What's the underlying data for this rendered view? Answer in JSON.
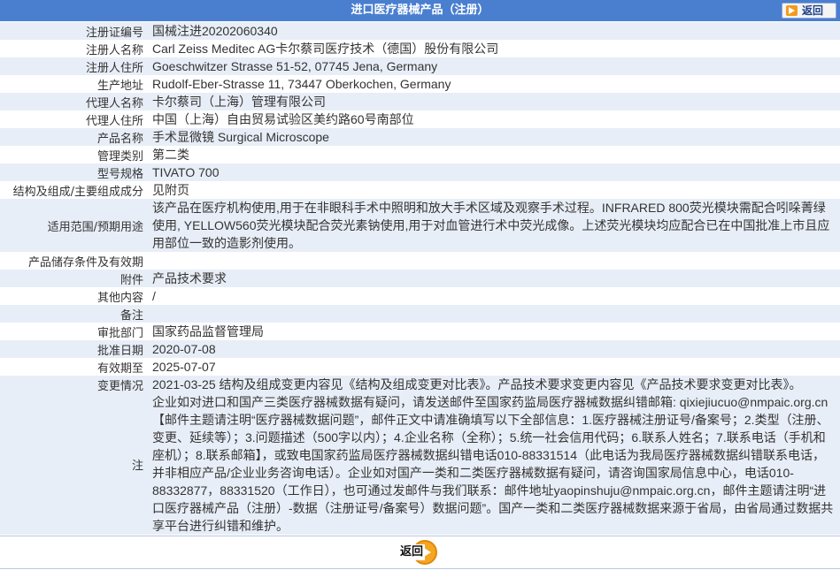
{
  "header": {
    "title": "进口医疗器械产品（注册）",
    "back_label": "返回"
  },
  "rows": [
    {
      "label": "注册证编号",
      "value": "国械注进20202060340"
    },
    {
      "label": "注册人名称",
      "value": "Carl Zeiss Meditec AG卡尔蔡司医疗技术（德国）股份有限公司"
    },
    {
      "label": "注册人住所",
      "value": "Goeschwitzer Strasse 51-52, 07745 Jena, Germany"
    },
    {
      "label": "生产地址",
      "value": "Rudolf-Eber-Strasse 11, 73447 Oberkochen, Germany"
    },
    {
      "label": "代理人名称",
      "value": "卡尔蔡司（上海）管理有限公司"
    },
    {
      "label": "代理人住所",
      "value": "中国（上海）自由贸易试验区美约路60号南部位"
    },
    {
      "label": "产品名称",
      "value": "手术显微镜 Surgical Microscope"
    },
    {
      "label": "管理类别",
      "value": "第二类"
    },
    {
      "label": "型号规格",
      "value": "TIVATO 700"
    },
    {
      "label": "结构及组成/主要组成成分",
      "value": "见附页"
    },
    {
      "label": "适用范围/预期用途",
      "value": "该产品在医疗机构使用,用于在非眼科手术中照明和放大手术区域及观察手术过程。INFRARED 800荧光模块需配合吲哚菁绿使用, YELLOW560荧光模块配合荧光素钠使用,用于对血管进行术中荧光成像。上述荧光模块均应配合已在中国批准上市且应用部位一致的造影剂使用。"
    },
    {
      "label": "产品储存条件及有效期",
      "value": ""
    },
    {
      "label": "附件",
      "value": "产品技术要求"
    },
    {
      "label": "其他内容",
      "value": "/"
    },
    {
      "label": "备注",
      "value": ""
    },
    {
      "label": "审批部门",
      "value": "国家药品监督管理局"
    },
    {
      "label": "批准日期",
      "value": "2020-07-08"
    },
    {
      "label": "有效期至",
      "value": "2025-07-07"
    },
    {
      "label": "变更情况",
      "value": "2021-03-25 结构及组成变更内容见《结构及组成变更对比表》。产品技术要求变更内容见《产品技术要求变更对比表》。"
    },
    {
      "label": "注",
      "value": "企业如对进口和国产三类医疗器械数据有疑问，请发送邮件至国家药监局医疗器械数据纠错邮箱: qixiejiucuo@nmpaic.org.cn【邮件主题请注明“医疗器械数据问题”，邮件正文中请准确填写以下全部信息：1.医疗器械注册证号/备案号；2.类型（注册、变更、延续等）；3.问题描述（500字以内）；4.企业名称（全称）；5.统一社会信用代码；6.联系人姓名；7.联系电话（手机和座机）；8.联系邮箱】，或致电国家药监局医疗器械数据纠错电话010-88331514（此电话为我局医疗器械数据纠错联系电话，并非相应产品/企业业务咨询电话）。企业如对国产一类和二类医疗器械数据有疑问，请咨询国家局信息中心，电话010-88332877，88331520（工作日），也可通过发邮件与我们联系：邮件地址yaopinshuju@nmpaic.org.cn，邮件主题请注明“进口医疗器械产品（注册）-数据（注册证号/备案号）数据问题”。国产一类和二类医疗器械数据来源于省局，由省局通过数据共享平台进行纠错和维护。"
    }
  ],
  "footer": {
    "back_label": "返回"
  }
}
